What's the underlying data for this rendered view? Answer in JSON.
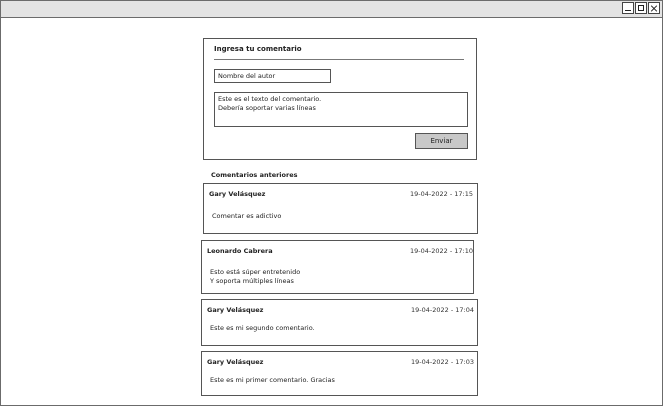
{
  "form": {
    "title": "Ingresa tu comentario",
    "author_placeholder": "Nombre del autor",
    "comment_text": "Este es el texto del comentario.\nDebería soportar varias líneas",
    "submit_label": "Enviar"
  },
  "comments": {
    "heading": "Comentarios anteriores",
    "items": [
      {
        "author": "Gary Velásquez",
        "date": "19-04-2022 - 17:15",
        "text": "Comentar es adictivo"
      },
      {
        "author": "Leonardo Cabrera",
        "date": "19-04-2022 - 17:10",
        "text": "Esto está súper entretenido\nY soporta múltiples líneas"
      },
      {
        "author": "Gary Velásquez",
        "date": "19-04-2022 - 17:04",
        "text": "Este es mi segundo comentario."
      },
      {
        "author": "Gary Velásquez",
        "date": "19-04-2022 - 17:03",
        "text": "Este es mi primer comentario. Gracias"
      }
    ]
  }
}
